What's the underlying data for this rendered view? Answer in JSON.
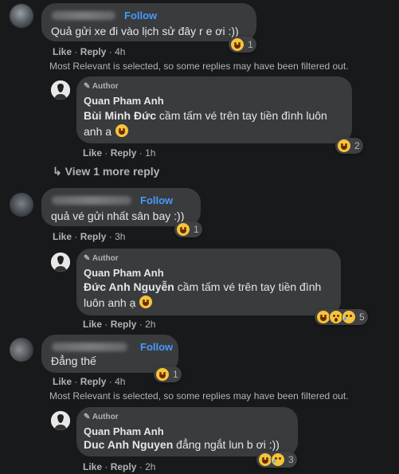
{
  "labels": {
    "like": "Like",
    "reply": "Reply",
    "dot": "·",
    "follow": "Follow",
    "author": "Author"
  },
  "filter_note": "Most Relevant is selected, so some replies may have been filtered out.",
  "c1": {
    "text": "Quả gửi xe đi vào lịch sử đây r e ơi :))",
    "time": "4h",
    "react_count": "1"
  },
  "r1": {
    "name": "Quan Pham Anh",
    "mention": "Bùi Minh Đức",
    "text_line1": " cầm tấm vé trên tay tiền đình luôn",
    "text_line2": "anh a ",
    "time": "1h",
    "react_count": "2"
  },
  "view_more": "View 1 more reply",
  "c2": {
    "text": "quả vé gửi nhất sân bay :))",
    "time": "3h",
    "react_count": "1"
  },
  "r2": {
    "name": "Quan Pham Anh",
    "mention": "Đức Anh Nguyễn",
    "text_line1": " cầm tấm vé trên tay tiền đình",
    "text_line2": "luôn anh ạ ",
    "time": "2h",
    "react_count": "5"
  },
  "c3": {
    "text": "Đẳng thế",
    "time": "4h",
    "react_count": "1"
  },
  "r3": {
    "name": "Quan Pham Anh",
    "mention": "Duc Anh Nguyen",
    "text": " đẳng ngắt lun b ơi :))",
    "time": "2h",
    "react_count": "3"
  },
  "colors": {
    "background": "#18191a",
    "bubble": "#3a3b3c",
    "link": "#4599ff",
    "muted": "#b0b3b8"
  }
}
